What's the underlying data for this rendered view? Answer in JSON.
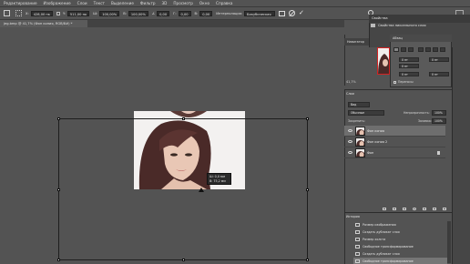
{
  "menubar": {
    "items": [
      "Редактирование",
      "Изображение",
      "Слои",
      "Текст",
      "Выделение",
      "Фильтр",
      "3D",
      "Просмотр",
      "Окно",
      "Справка"
    ]
  },
  "options_bar": {
    "x_value": "428,00 пк",
    "y_value": "511,00 пк",
    "w_value": "100,00%",
    "h_value": "100,00%",
    "angle_value": "0,00",
    "h_skew": "0,00",
    "v_skew": "0,00",
    "interp_label": "Интерполяция:",
    "interp_value": "Бикубическая"
  },
  "document": {
    "tab_title": "jeg.bmp @ 41,7% (Фон копия, RGB/8#) *"
  },
  "transform_tooltip": {
    "line1": "Ш: 0,0 мм",
    "line2": "В: 75,2 мм"
  },
  "navigator": {
    "tab_label": "Навигатор",
    "zoom": "41,7%"
  },
  "properties": {
    "title": "Свойства",
    "subtitle": "Свойства пиксельного слоя"
  },
  "paragraph": {
    "title": "Абзац",
    "fields": [
      "0 пт",
      "0 пт",
      "0 пт",
      "0 пт",
      "0 пт"
    ],
    "hyphen_label": "Переносы"
  },
  "layers": {
    "tab_label": "Слои",
    "filter_label": "Вид",
    "blend_mode": "Обычные",
    "opacity_label": "Непрозрачность:",
    "opacity_value": "100%",
    "lock_label": "Закрепить:",
    "fill_label": "Заливка:",
    "fill_value": "100%",
    "rows": [
      {
        "name": "Фон копия"
      },
      {
        "name": "Фон копия 2"
      },
      {
        "name": "Фон"
      }
    ]
  },
  "history": {
    "tab_label": "История",
    "items": [
      "Размер изображения",
      "Создать дубликат слоя",
      "Размер холста",
      "Свободное трансформирование",
      "Создать дубликат слоя",
      "Свободное трансформирование"
    ]
  },
  "colors": {
    "ui_bg": "#535353",
    "panel_dark": "#3b3b3b",
    "nav_highlight": "#d42323"
  }
}
